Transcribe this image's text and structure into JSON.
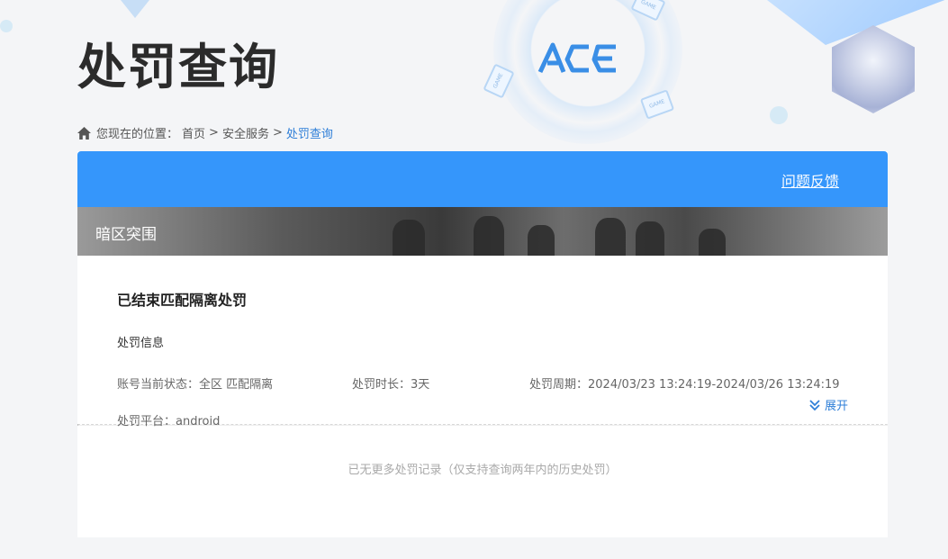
{
  "page": {
    "title": "处罚查询"
  },
  "breadcrumb": {
    "prefix": "您现在的位置：",
    "items": [
      {
        "label": "首页"
      },
      {
        "label": "安全服务"
      },
      {
        "label": "处罚查询"
      }
    ],
    "separator": ">"
  },
  "header": {
    "feedback_label": "问题反馈"
  },
  "game": {
    "name": "暗区突围"
  },
  "record": {
    "title": "已结束匹配隔离处罚",
    "section_label": "处罚信息",
    "status": "账号当前状态：全区 匹配隔离",
    "duration": "处罚时长：3天",
    "period": "处罚周期：2024/03/23 13:24:19-2024/03/26 13:24:19",
    "platform": "处罚平台：android",
    "expand_label": "展开"
  },
  "footer": {
    "no_more_text": "已无更多处罚记录（仅支持查询两年内的历史处罚）"
  },
  "colors": {
    "accent": "#3596fb",
    "link": "#2f7fd8"
  }
}
